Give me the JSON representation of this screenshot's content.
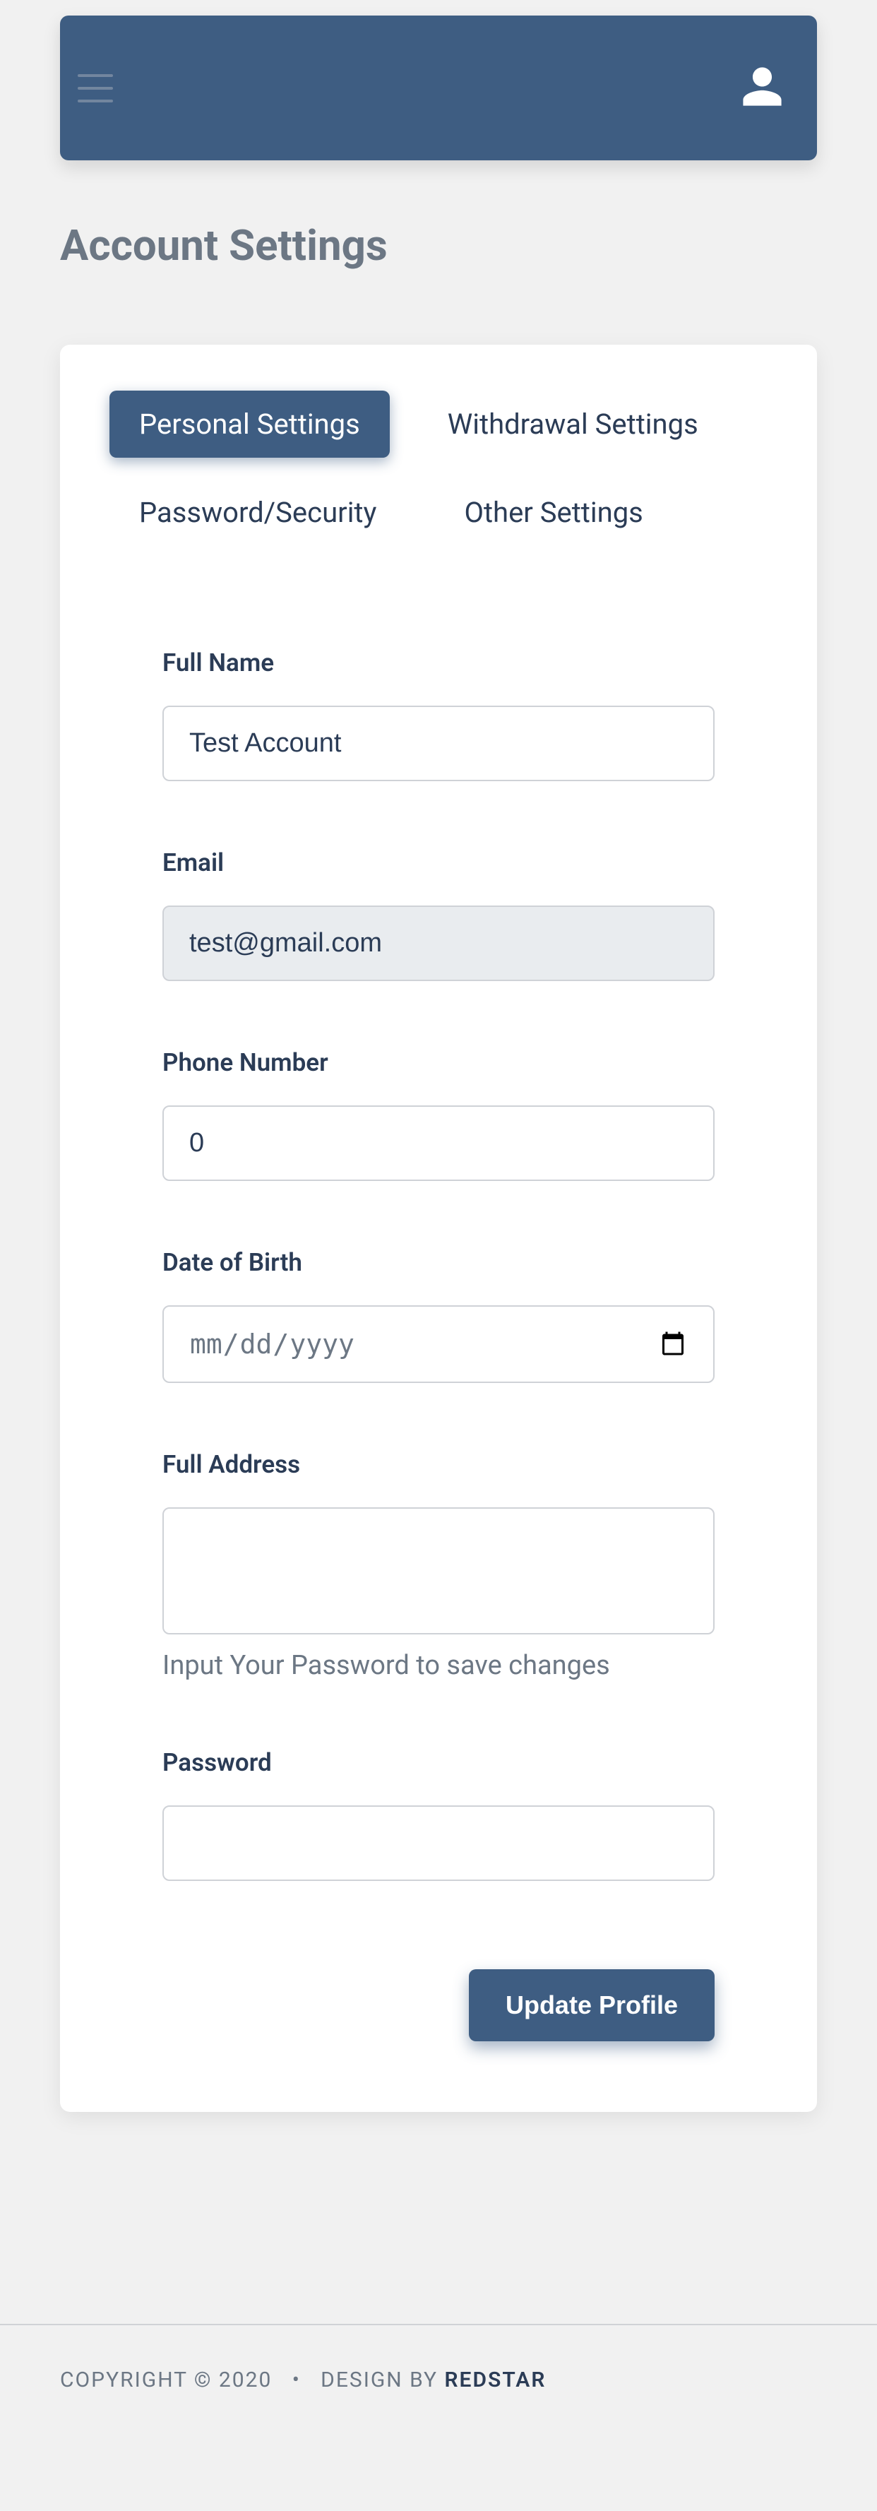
{
  "page": {
    "title": "Account Settings"
  },
  "tabs": [
    {
      "label": "Personal Settings",
      "active": true
    },
    {
      "label": "Withdrawal Settings",
      "active": false
    },
    {
      "label": "Password/Security",
      "active": false
    },
    {
      "label": "Other Settings",
      "active": false
    }
  ],
  "form": {
    "full_name": {
      "label": "Full Name",
      "value": "Test Account"
    },
    "email": {
      "label": "Email",
      "value": "test@gmail.com",
      "readonly": true
    },
    "phone": {
      "label": "Phone Number",
      "value": "0"
    },
    "dob": {
      "label": "Date of Birth",
      "placeholder": "mm/dd/yyyy",
      "value": ""
    },
    "address": {
      "label": "Full Address",
      "value": ""
    },
    "password_helper": "Input Your Password to save changes",
    "password": {
      "label": "Password",
      "value": ""
    },
    "submit_label": "Update Profile"
  },
  "footer": {
    "copyright": "COPYRIGHT © 2020",
    "separator": "•",
    "design_by_prefix": "DESIGN BY ",
    "brand": "REDSTAR"
  }
}
